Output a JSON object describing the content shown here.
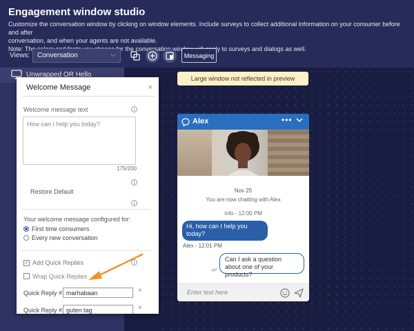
{
  "header": {
    "title": "Engagement window studio",
    "description_line1": "Customize the conversation window by clicking on window elements. Include surveys to collect additional information on your consumer before and after",
    "description_line2": "conversation, and when your agents are not available.",
    "description_line3": "Note: The colors and fonts you choose for the conversation window will apply to surveys and dialogs as well."
  },
  "toolbar": {
    "views_label": "Views:",
    "views_value": "Conversation",
    "messaging_label": "Messaging"
  },
  "left_panel": {
    "row_label": "Unwrapped OR Hello"
  },
  "banner": {
    "text": "Large window not reflected in preview"
  },
  "modal": {
    "title": "Welcome Message",
    "close": "×",
    "welcome_label": "Welcome message text",
    "welcome_placeholder": "How can I help you today?",
    "counter": "175/200",
    "restore_label": "Restore Default",
    "configured_for_label": "Your welcome message configured for:",
    "options": [
      {
        "label": "First time consumers",
        "selected": true
      },
      {
        "label": "Every new conversation",
        "selected": false
      }
    ],
    "add_quick_replies": {
      "label": "Add Quick Replies",
      "checked": true
    },
    "wrap_quick_replies": {
      "label": "Wrap Quick Replies",
      "checked": false
    },
    "quick_replies": [
      {
        "label": "Quick Reply #1",
        "value": "marhabaan"
      },
      {
        "label": "Quick Reply #2",
        "value": "guten tag"
      }
    ]
  },
  "chat": {
    "agent_name": "Alex",
    "date": "Nov 25",
    "now_chatting": "You are now chatting with Alex",
    "info_time": "Info - 12:00 PM",
    "agent_message": "Hi, how can I help you today?",
    "agent_time": "Alex - 12:01 PM",
    "user_message": "Can I ask a question about one of your products?",
    "input_placeholder": "Enter text here"
  },
  "colors": {
    "background": "#1a1d42",
    "header": "#262b5a",
    "chat_header": "#2a6ebf",
    "agent_bubble": "#2a5fa8",
    "banner": "#fdf0c4",
    "arrow": "#f0932b"
  }
}
